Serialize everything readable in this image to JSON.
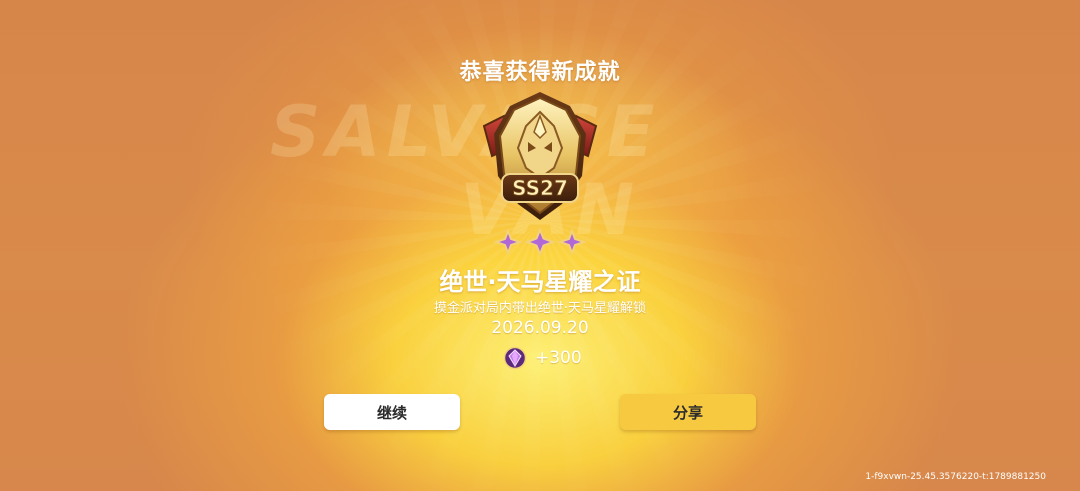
{
  "popup": {
    "title": "恭喜获得新成就",
    "watermark_line1": "SALVAGE",
    "watermark_line2": "VAN",
    "badge": {
      "icon": "pegasus-helmet-badge-icon",
      "label": "SS27"
    },
    "star_count": 3,
    "achievement_name": "绝世·天马星耀之证",
    "description": "摸金派对局内带出绝世·天马星耀解锁",
    "date": "2026.09.20",
    "reward": {
      "icon": "gem-icon",
      "amount": "+300"
    }
  },
  "buttons": {
    "continue_label": "继续",
    "share_label": "分享"
  },
  "footer": {
    "session_id": "1-f9xvwn-25.45.3576220-t:1789881250"
  },
  "colors": {
    "accent_yellow": "#f7c940",
    "background_orange": "#d98a4a",
    "badge_gold": "#e8c464"
  }
}
